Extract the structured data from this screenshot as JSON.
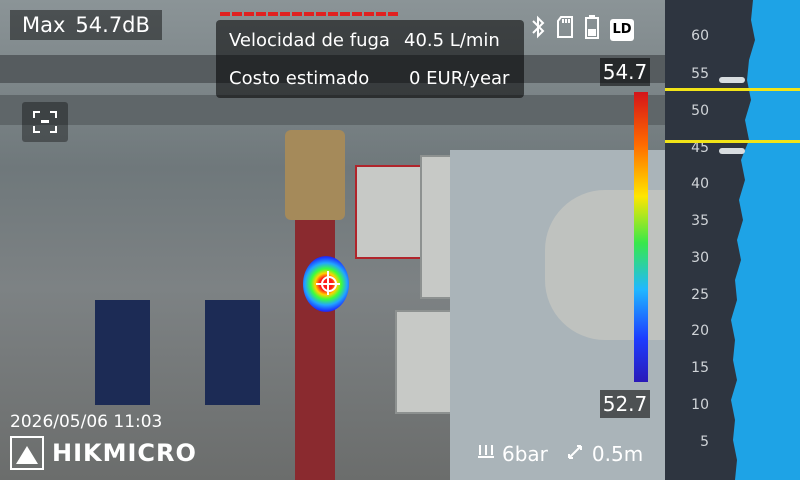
{
  "status": {
    "max_label": "Max",
    "max_value": "54.7dB",
    "icons": [
      "bluetooth-icon",
      "sd-card-icon",
      "battery-icon",
      "ld-badge"
    ],
    "ld_label": "LD"
  },
  "leak_info": {
    "rows": [
      {
        "label": "Velocidad de fuga",
        "value": "40.5 L/min"
      },
      {
        "label": "Costo estimado",
        "value": "0 EUR/year"
      }
    ]
  },
  "color_scale": {
    "top": "54.7",
    "bottom": "52.7"
  },
  "footer": {
    "datetime": "2026/05/06 11:03",
    "brand": "HIKMICRO",
    "pressure": "6bar",
    "distance": "0.5m"
  },
  "spectrum": {
    "ticks": [
      "60",
      "55",
      "50",
      "45",
      "40",
      "35",
      "30",
      "25",
      "20",
      "15",
      "10",
      "5"
    ],
    "threshold_colors": "#f2e418",
    "fill_color": "#1ea3e6"
  }
}
